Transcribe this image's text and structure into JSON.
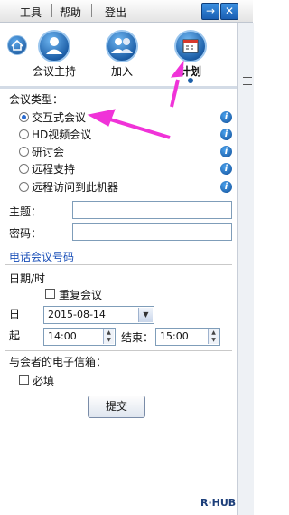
{
  "menu": {
    "tools": "工具",
    "help": "帮助",
    "logout": "登出"
  },
  "nav": {
    "items": [
      {
        "label": "会议主持",
        "icon": "person-icon"
      },
      {
        "label": "加入",
        "icon": "group-icon"
      },
      {
        "label": "计划",
        "icon": "calendar-icon",
        "active": true
      }
    ]
  },
  "form": {
    "meeting_type_label": "会议类型：",
    "meeting_types": [
      {
        "label": "交互式会议",
        "selected": true
      },
      {
        "label": "HD视频会议",
        "selected": false
      },
      {
        "label": "研讨会",
        "selected": false
      },
      {
        "label": "远程支持",
        "selected": false
      },
      {
        "label": "远程访问到此机器",
        "selected": false
      }
    ],
    "subject_label": "主题：",
    "password_label": "密码：",
    "phone_link": "电话会议号码",
    "datetime_label": "日期/时",
    "repeat_label": "重复会议",
    "day_label": "日",
    "start_label": "起",
    "date_value": "2015-08-14",
    "start_time": "14:00",
    "end_label": "结束：",
    "end_time": "15:00",
    "email_label": "与会者的电子信箱：",
    "required_label": "必填",
    "submit_label": "提交"
  },
  "logo": "R·HUB",
  "colors": {
    "accent": "#1d5fa8",
    "arrow": "#f033d8",
    "link": "#1a4fb8"
  }
}
